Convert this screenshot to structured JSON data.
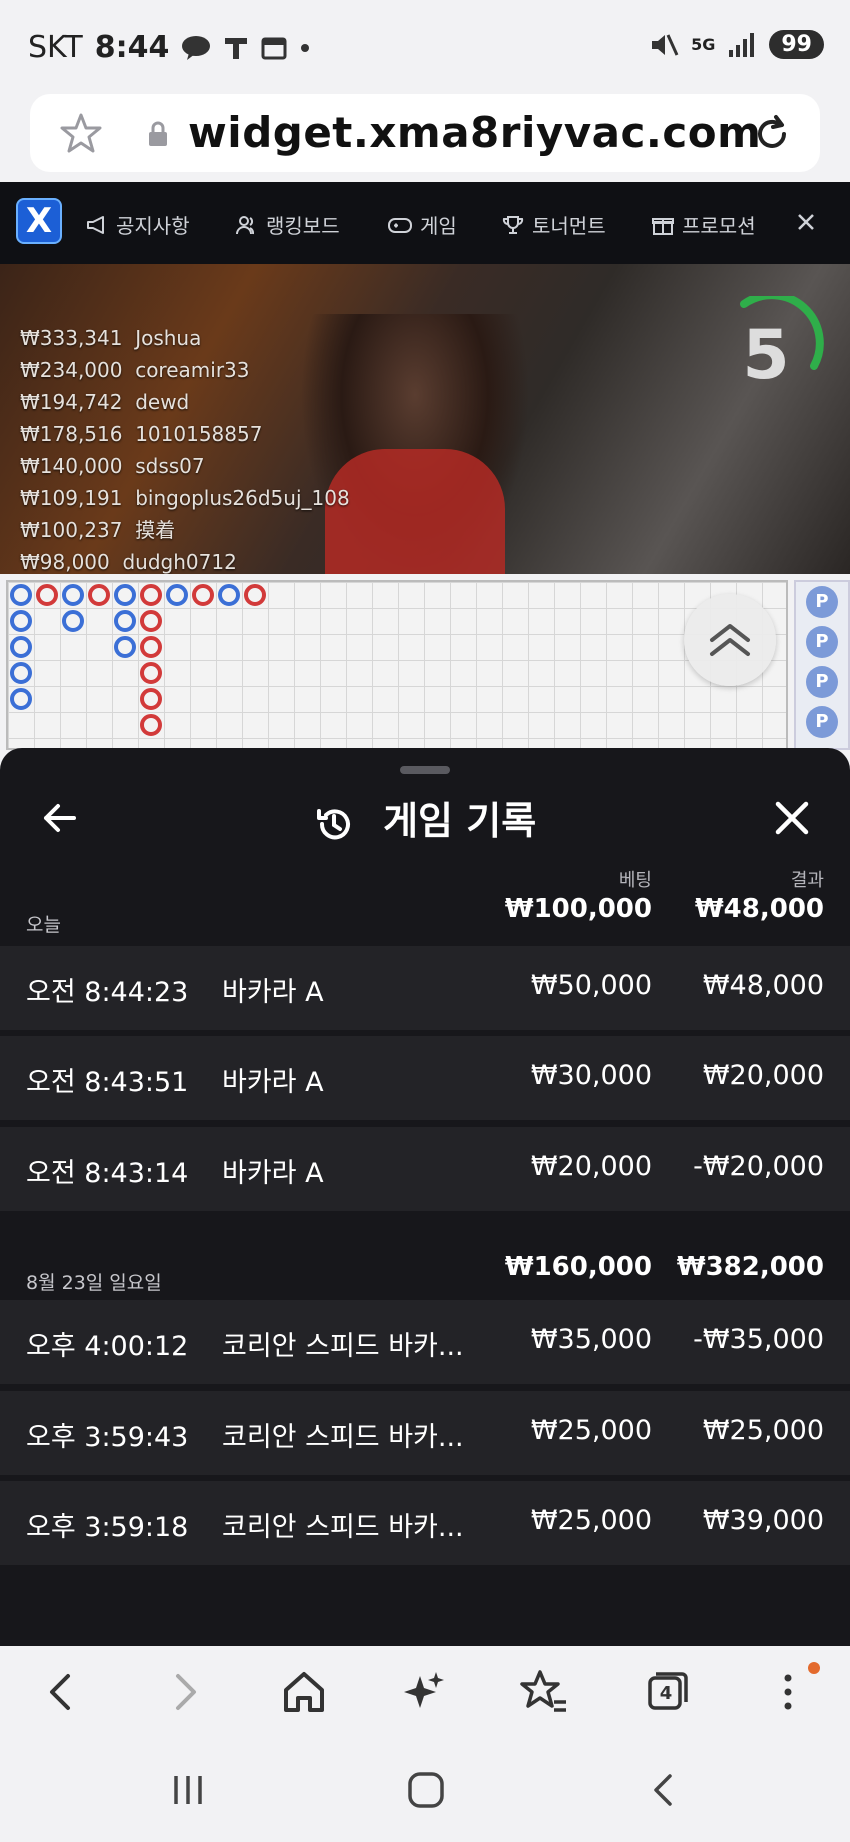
{
  "status": {
    "carrier": "SKT",
    "time": "8:44",
    "battery": "99",
    "network": "5G"
  },
  "browser": {
    "url": "widget.xma8riyvac.com",
    "tabs_count": "4"
  },
  "site_nav": {
    "items": [
      {
        "label": "공지사항",
        "icon": "megaphone-icon"
      },
      {
        "label": "랭킹보드",
        "icon": "users-icon"
      },
      {
        "label": "게임",
        "icon": "gamepad-icon"
      },
      {
        "label": "토너먼트",
        "icon": "trophy-icon"
      },
      {
        "label": "프로모션",
        "icon": "gift-icon"
      }
    ]
  },
  "live": {
    "countdown": "5",
    "winners": [
      {
        "amount": "₩333,341",
        "name": "Joshua"
      },
      {
        "amount": "₩234,000",
        "name": "coreamir33"
      },
      {
        "amount": "₩194,742",
        "name": "dewd"
      },
      {
        "amount": "₩178,516",
        "name": "1010158857"
      },
      {
        "amount": "₩140,000",
        "name": "sdss07"
      },
      {
        "amount": "₩109,191",
        "name": "bingoplus26d5uj_108"
      },
      {
        "amount": "₩100,237",
        "name": "摸着"
      },
      {
        "amount": "₩98,000",
        "name": "dudgh0712"
      }
    ],
    "p_badge": "P"
  },
  "history": {
    "title": "게임 기록",
    "col_bet": "베팅",
    "col_result": "결과",
    "groups": [
      {
        "label": "오늘",
        "bet_total": "₩100,000",
        "result_total": "₩48,000",
        "entries": [
          {
            "time": "오전 8:44:23",
            "game": "바카라 A",
            "bet": "₩50,000",
            "result": "₩48,000"
          },
          {
            "time": "오전 8:43:51",
            "game": "바카라 A",
            "bet": "₩30,000",
            "result": "₩20,000"
          },
          {
            "time": "오전 8:43:14",
            "game": "바카라 A",
            "bet": "₩20,000",
            "result": "-₩20,000"
          }
        ]
      },
      {
        "label": "8월 23일 일요일",
        "bet_total": "₩160,000",
        "result_total": "₩382,000",
        "entries": [
          {
            "time": "오후 4:00:12",
            "game": "코리안 스피드 바카...",
            "bet": "₩35,000",
            "result": "-₩35,000"
          },
          {
            "time": "오후 3:59:43",
            "game": "코리안 스피드 바카...",
            "bet": "₩25,000",
            "result": "₩25,000"
          },
          {
            "time": "오후 3:59:18",
            "game": "코리안 스피드 바카...",
            "bet": "₩25,000",
            "result": "₩39,000"
          }
        ]
      }
    ]
  },
  "colors": {
    "accent_orange": "#e36a2d",
    "sheet_bg": "#17171b",
    "row_bg": "#232327",
    "banker_red": "#d23a3a",
    "player_blue": "#3b6fd6"
  }
}
